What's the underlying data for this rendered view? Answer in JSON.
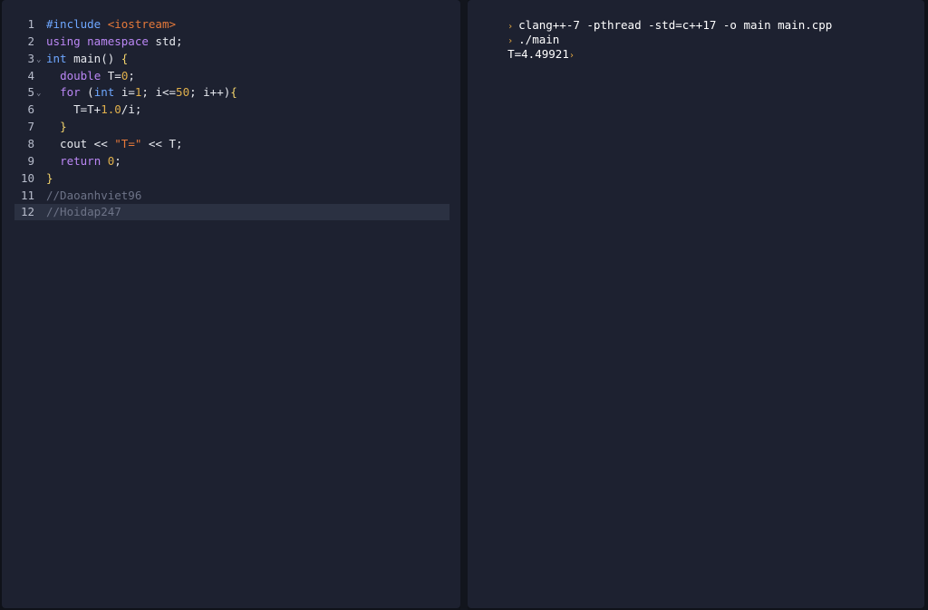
{
  "editor": {
    "lines": [
      {
        "no": "1",
        "parts": [
          {
            "t": "#include ",
            "c": "pp"
          },
          {
            "t": "<iostream>",
            "c": "str"
          }
        ]
      },
      {
        "no": "2",
        "parts": [
          {
            "t": "using ",
            "c": "kw"
          },
          {
            "t": "namespace ",
            "c": "kw"
          },
          {
            "t": "std;",
            "c": ""
          }
        ]
      },
      {
        "no": "3",
        "fold": true,
        "parts": [
          {
            "t": "int ",
            "c": "ty"
          },
          {
            "t": "main() ",
            "c": ""
          },
          {
            "t": "{",
            "c": "bracket"
          }
        ]
      },
      {
        "no": "4",
        "parts": [
          {
            "t": "  ",
            "c": ""
          },
          {
            "t": "double ",
            "c": "kw"
          },
          {
            "t": "T=",
            "c": ""
          },
          {
            "t": "0",
            "c": "num"
          },
          {
            "t": ";",
            "c": ""
          }
        ]
      },
      {
        "no": "5",
        "fold": true,
        "parts": [
          {
            "t": "  ",
            "c": ""
          },
          {
            "t": "for ",
            "c": "kw"
          },
          {
            "t": "(",
            "c": ""
          },
          {
            "t": "int ",
            "c": "ty"
          },
          {
            "t": "i=",
            "c": ""
          },
          {
            "t": "1",
            "c": "num"
          },
          {
            "t": "; i<=",
            "c": ""
          },
          {
            "t": "50",
            "c": "num"
          },
          {
            "t": "; i++)",
            "c": ""
          },
          {
            "t": "{",
            "c": "bracket"
          }
        ]
      },
      {
        "no": "6",
        "parts": [
          {
            "t": "    T=T+",
            "c": ""
          },
          {
            "t": "1.0",
            "c": "num"
          },
          {
            "t": "/i;",
            "c": ""
          }
        ]
      },
      {
        "no": "7",
        "parts": [
          {
            "t": "  ",
            "c": ""
          },
          {
            "t": "}",
            "c": "bracket"
          }
        ]
      },
      {
        "no": "8",
        "parts": [
          {
            "t": "  cout << ",
            "c": ""
          },
          {
            "t": "\"T=\"",
            "c": "str"
          },
          {
            "t": " << T;",
            "c": ""
          }
        ]
      },
      {
        "no": "9",
        "parts": [
          {
            "t": "  ",
            "c": ""
          },
          {
            "t": "return ",
            "c": "kw"
          },
          {
            "t": "0",
            "c": "num"
          },
          {
            "t": ";",
            "c": ""
          }
        ]
      },
      {
        "no": "10",
        "parts": [
          {
            "t": "}",
            "c": "bracket"
          }
        ]
      },
      {
        "no": "11",
        "parts": [
          {
            "t": "//Daoanhviet96",
            "c": "cm"
          }
        ]
      },
      {
        "no": "12",
        "active": true,
        "parts": [
          {
            "t": "//Hoidap247",
            "c": "cm"
          }
        ]
      }
    ]
  },
  "console": {
    "prompt_icon": "chevron-prompt-icon",
    "command1": "clang++-7 -pthread -std=c++17 -o main main.cpp",
    "command2": "./main",
    "output": "T=4.49921"
  },
  "colors": {
    "editor_bg": "#1d2130",
    "prompt": "#e0a640"
  }
}
